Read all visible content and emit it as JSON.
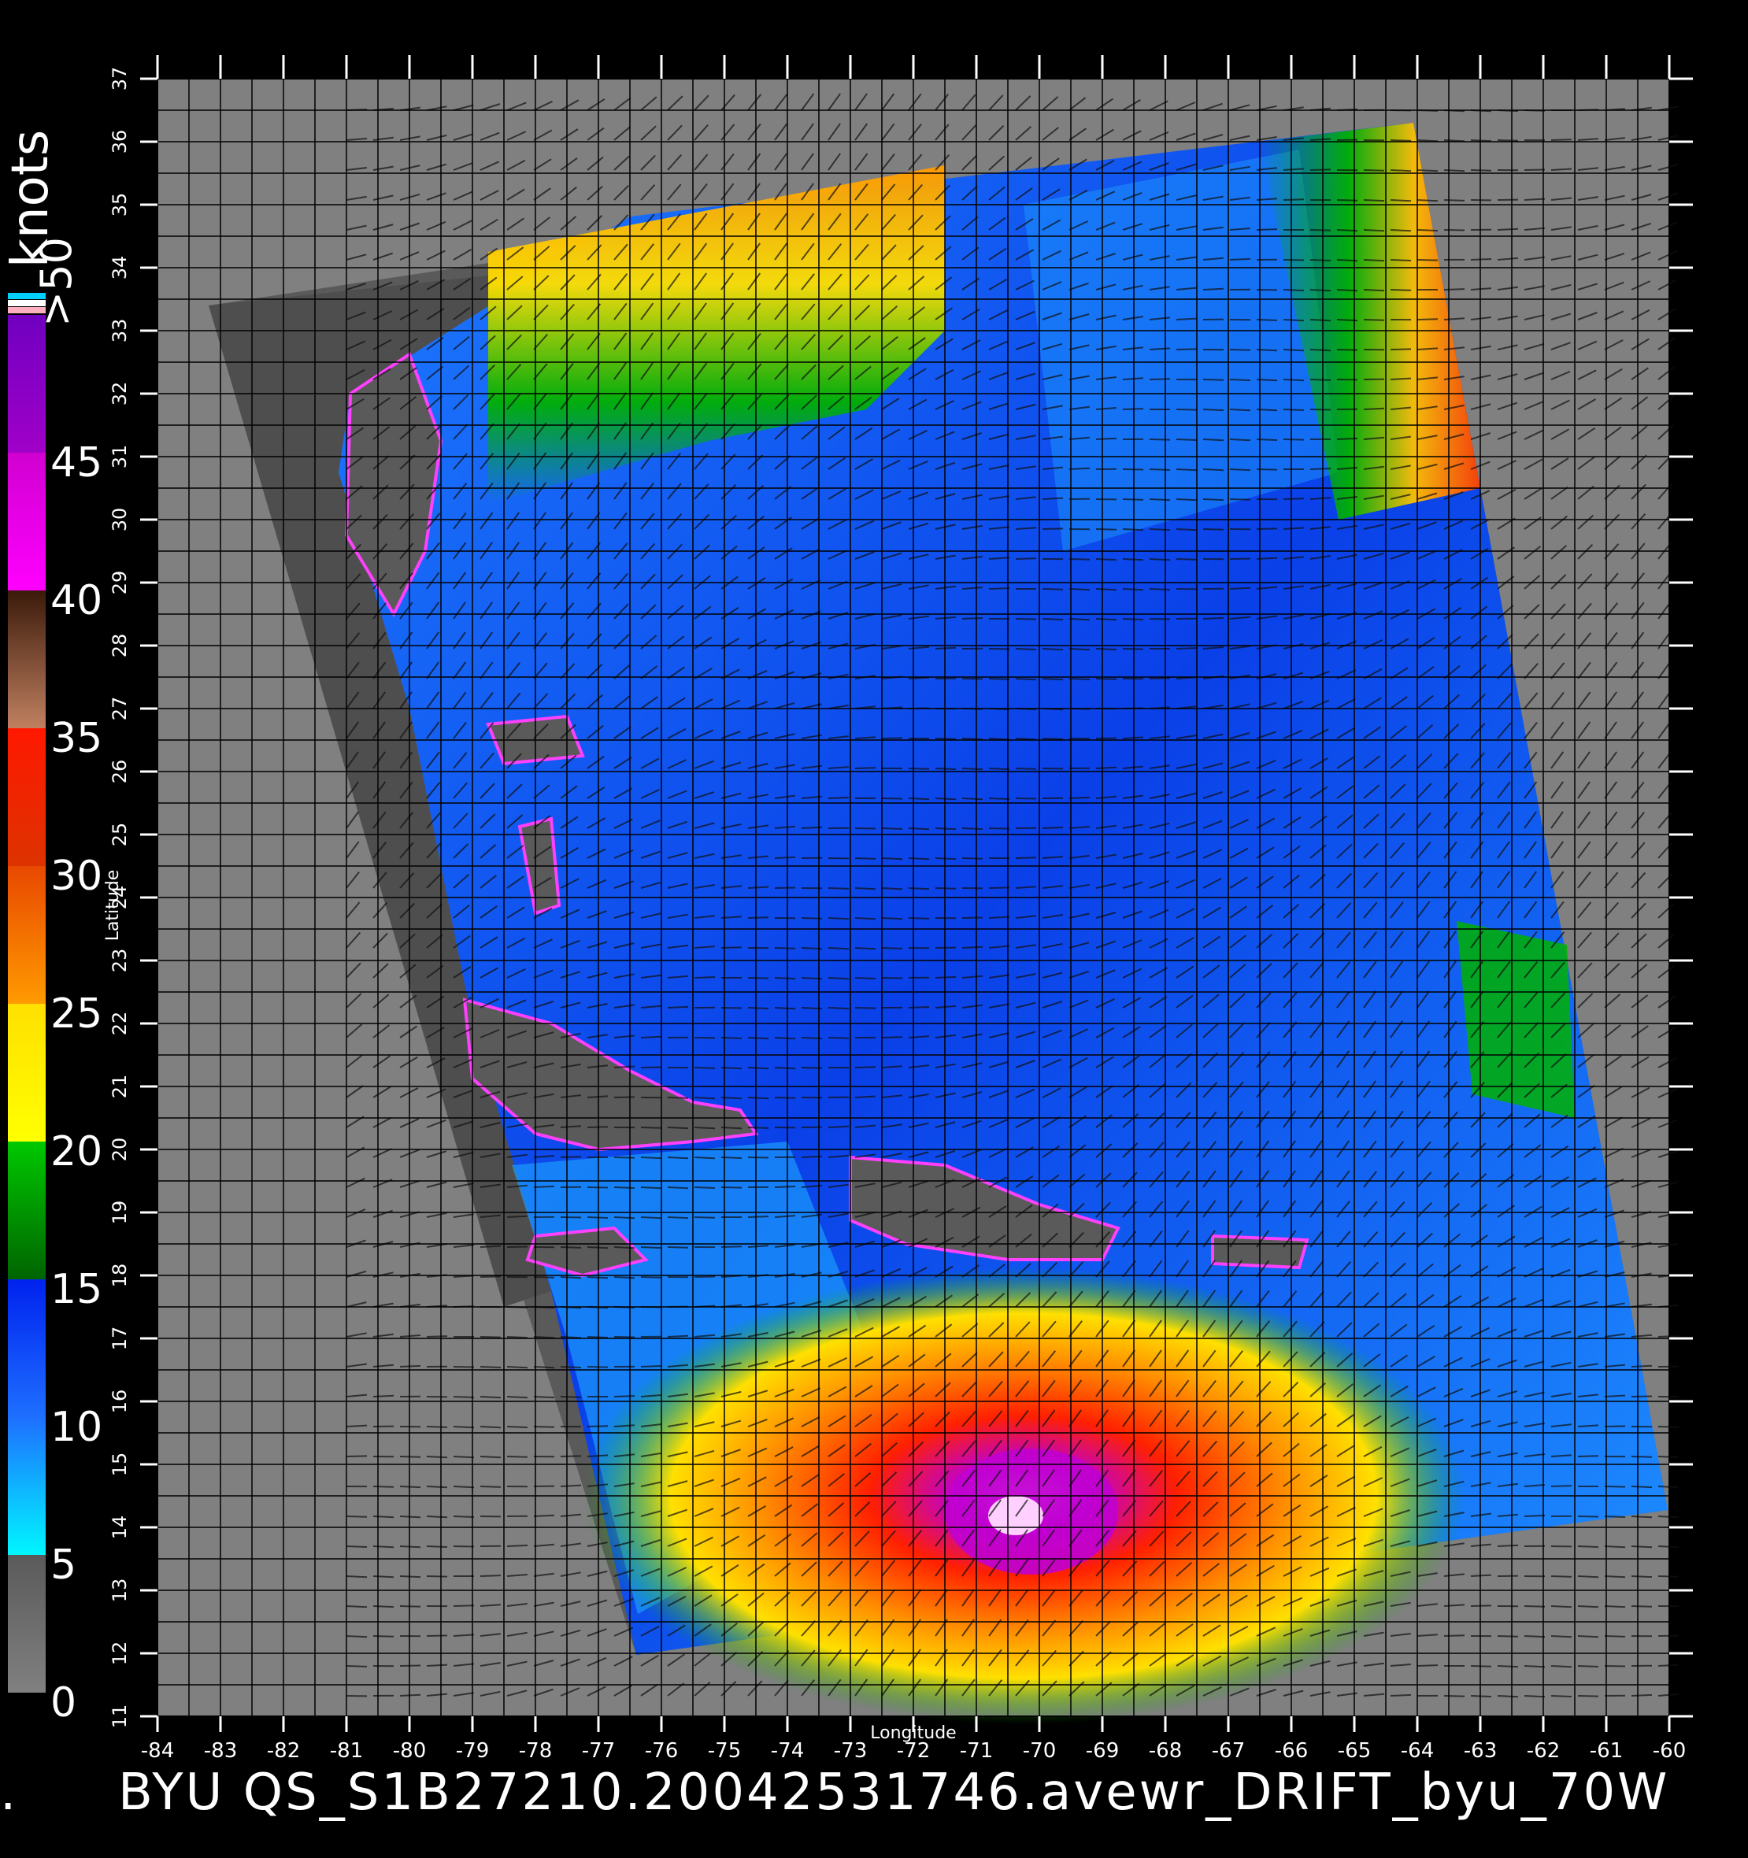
{
  "colorbar": {
    "unit": "knots",
    "overflow_label": ">50",
    "levels": [
      {
        "label": "0"
      },
      {
        "label": "5"
      },
      {
        "label": "10"
      },
      {
        "label": "15"
      },
      {
        "label": "20"
      },
      {
        "label": "25"
      },
      {
        "label": "30"
      },
      {
        "label": "35"
      },
      {
        "label": "40"
      },
      {
        "label": "45"
      }
    ],
    "bands": [
      {
        "from": 0,
        "to": 5,
        "top": "#5a5a5a",
        "bottom": "#808080"
      },
      {
        "from": 5,
        "to": 10,
        "top": "#1e6fff",
        "bottom": "#00f6ff"
      },
      {
        "from": 10,
        "to": 15,
        "top": "#0022ee",
        "bottom": "#1e6fff"
      },
      {
        "from": 15,
        "to": 20,
        "top": "#00c800",
        "bottom": "#006400"
      },
      {
        "from": 20,
        "to": 25,
        "top": "#ffe000",
        "bottom": "#ffff00"
      },
      {
        "from": 25,
        "to": 30,
        "top": "#e84800",
        "bottom": "#ff9a00"
      },
      {
        "from": 30,
        "to": 35,
        "top": "#ff1800",
        "bottom": "#dd3300"
      },
      {
        "from": 35,
        "to": 40,
        "top": "#3a1a0a",
        "bottom": "#c08060"
      },
      {
        "from": 40,
        "to": 45,
        "top": "#d000d0",
        "bottom": "#ff00ff"
      },
      {
        "from": 45,
        "to": 50,
        "top": "#7000c0",
        "bottom": "#a000c8"
      }
    ]
  },
  "axes": {
    "xlabel": "Longitude",
    "ylabel": "Latitude",
    "x_ticks": [
      "-84",
      "-83",
      "-82",
      "-81",
      "-80",
      "-79",
      "-78",
      "-77",
      "-76",
      "-75",
      "-74",
      "-73",
      "-72",
      "-71",
      "-70",
      "-69",
      "-68",
      "-67",
      "-66",
      "-65",
      "-64",
      "-63",
      "-62",
      "-61",
      "-60"
    ],
    "y_ticks": [
      "11",
      "12",
      "13",
      "14",
      "15",
      "16",
      "17",
      "18",
      "19",
      "20",
      "21",
      "22",
      "23",
      "24",
      "25",
      "26",
      "27",
      "28",
      "29",
      "30",
      "31",
      "32",
      "33",
      "34",
      "35",
      "36",
      "37"
    ]
  },
  "caption": "BYU  QS_S1B27210.20042531746.avewr_DRIFT_byu_70W",
  "caption_left": ".",
  "colors": {
    "background": "#000000",
    "land_gray": "#808080",
    "land_dark": "#5a5a5a",
    "swath_dark": "#5a5a5a"
  }
}
